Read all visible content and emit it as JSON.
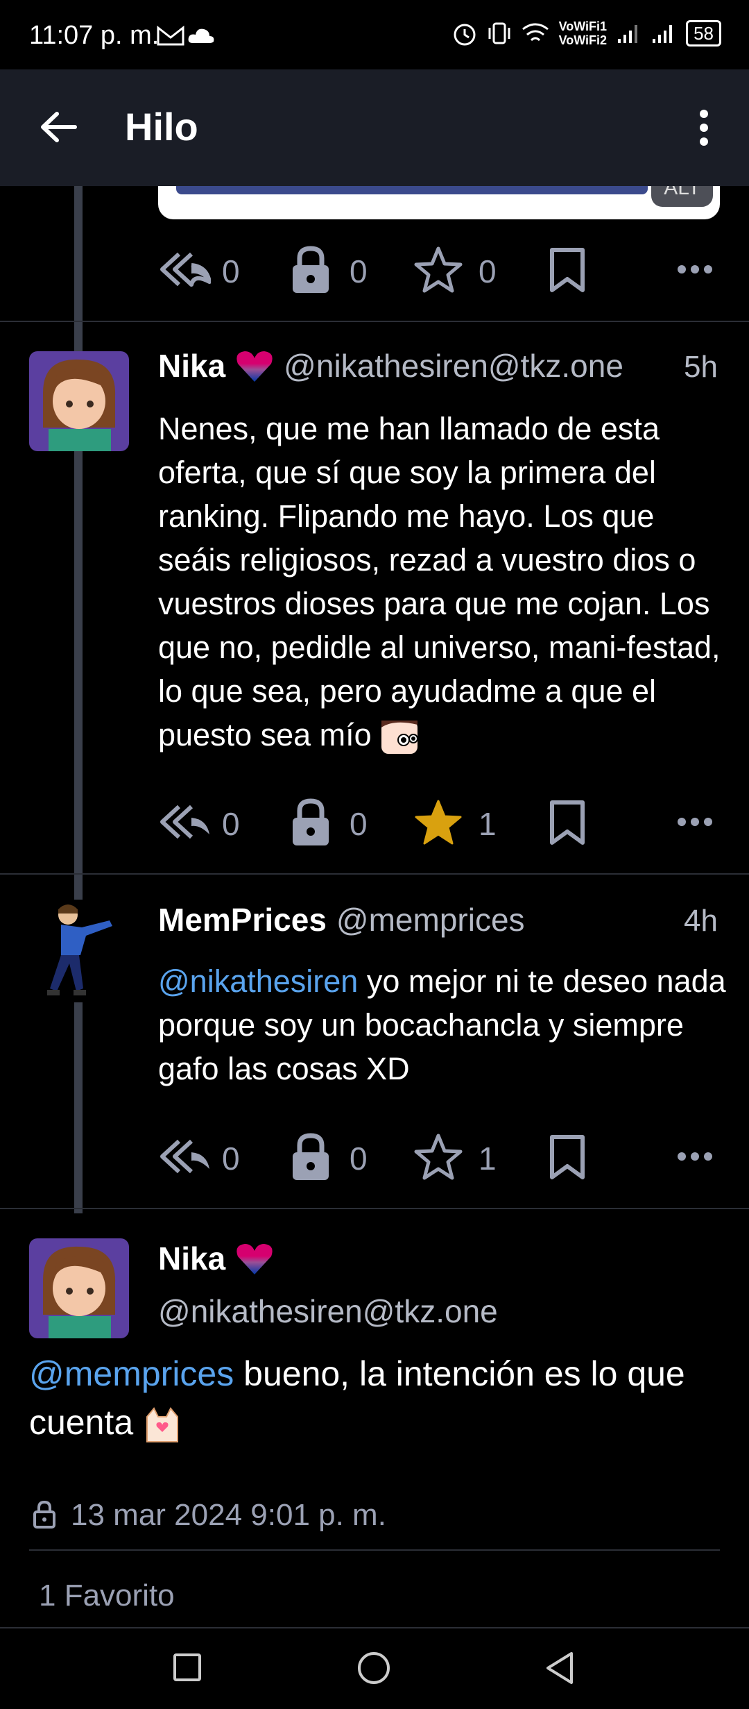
{
  "status_bar": {
    "time": "11:07 p. m.",
    "network_1": "VoWiFi1",
    "network_2": "VoWiFi2",
    "battery": "58"
  },
  "app_bar": {
    "title": "Hilo"
  },
  "colors": {
    "accent": "#5aa4ee",
    "star": "#d9a10f",
    "background": "#000000",
    "app_bar": "#1a1d26"
  },
  "top_card": {
    "alt_badge": "ALT"
  },
  "post_0": {
    "replies": "0",
    "boosts": "0",
    "favs": "0"
  },
  "post_1": {
    "name": "Nika",
    "handle": "@nikathesiren@tkz.one",
    "time": "5h",
    "text": "Nenes, que me han llamado de esta oferta, que sí que soy la primera del ranking. Flipando me hayo. Los que seáis religiosos, rezad a vuestro dios o vuestros dioses para que me cojan. Los que no, pedidle al universo, mani-festad, lo que sea, pero ayudadme a que el puesto sea mío",
    "replies": "0",
    "boosts": "0",
    "favs": "1"
  },
  "post_2": {
    "name": "MemPrices",
    "handle": "@memprices",
    "time": "4h",
    "mention": "@nikathesiren",
    "text": " yo mejor ni te deseo nada porque soy un bocachancla y siempre gafo las cosas XD",
    "replies": "0",
    "boosts": "0",
    "favs": "1"
  },
  "focused_post": {
    "name": "Nika",
    "handle": "@nikathesiren@tkz.one",
    "mention": "@memprices",
    "text": " bueno, la intención es lo que cuenta",
    "date": "13 mar 2024 9:01 p. m.",
    "favorites_label": "1 Favorito"
  },
  "icons": [
    "back-arrow-icon",
    "more-vert-icon",
    "reply-all-icon",
    "lock-icon",
    "star-icon",
    "bookmark-icon",
    "more-horiz-icon",
    "heart-icon",
    "nav-square-icon",
    "nav-circle-icon",
    "nav-back-triangle-icon"
  ]
}
